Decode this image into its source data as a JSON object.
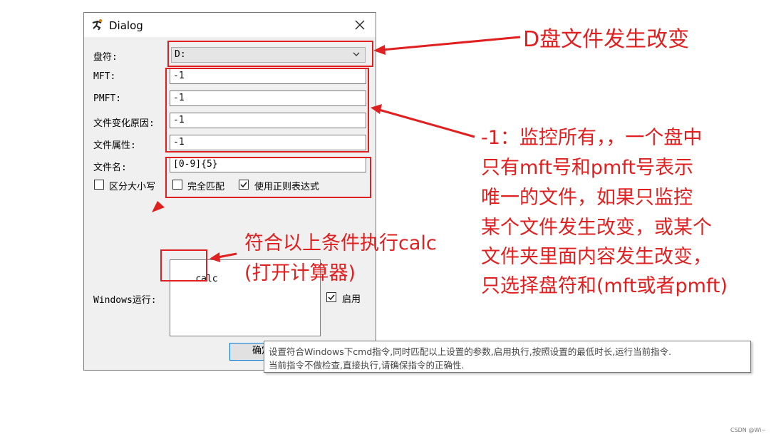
{
  "dialog": {
    "title": "Dialog",
    "fields": {
      "drive_label": "盘符:",
      "drive_value": "D:",
      "mft_label": "MFT:",
      "mft_value": "-1",
      "pmft_label": "PMFT:",
      "pmft_value": "-1",
      "reason_label": "文件变化原因:",
      "reason_value": "-1",
      "attr_label": "文件属性:",
      "attr_value": "-1",
      "filename_label": "文件名:",
      "filename_value": "[0-9]{5}"
    },
    "options": {
      "case_sensitive": {
        "label": "区分大小写",
        "checked": false
      },
      "full_match": {
        "label": "完全匹配",
        "checked": false
      },
      "use_regex": {
        "label": "使用正则表达式",
        "checked": true
      }
    },
    "windows_run": {
      "label": "Windows运行:",
      "command": "calc",
      "enable": {
        "label": "启用",
        "checked": true
      }
    },
    "ok_button": "确定"
  },
  "tooltip": {
    "line1": "设置符合Windows下cmd指令,同时匹配以上设置的参数,启用执行,按照设置的最低时长,运行当前指令.",
    "line2": "当前指令不做检查,直接执行,请确保指令的正确性."
  },
  "annotations": {
    "drive": "D盘文件发生改变",
    "minus_one": [
      "-1：监控所有，，一个盘中",
      "只有mft号和pmft号表示",
      "唯一的文件，如果只监控",
      "某个文件发生改变，或某个",
      "文件夹里面内容发生改变，",
      "只选择盘符和(mft或者pmft)"
    ],
    "calc": [
      "符合以上条件执行calc",
      "(打开计算器)"
    ],
    "color": "#e02020"
  },
  "watermark": "CSDN @Wi~"
}
